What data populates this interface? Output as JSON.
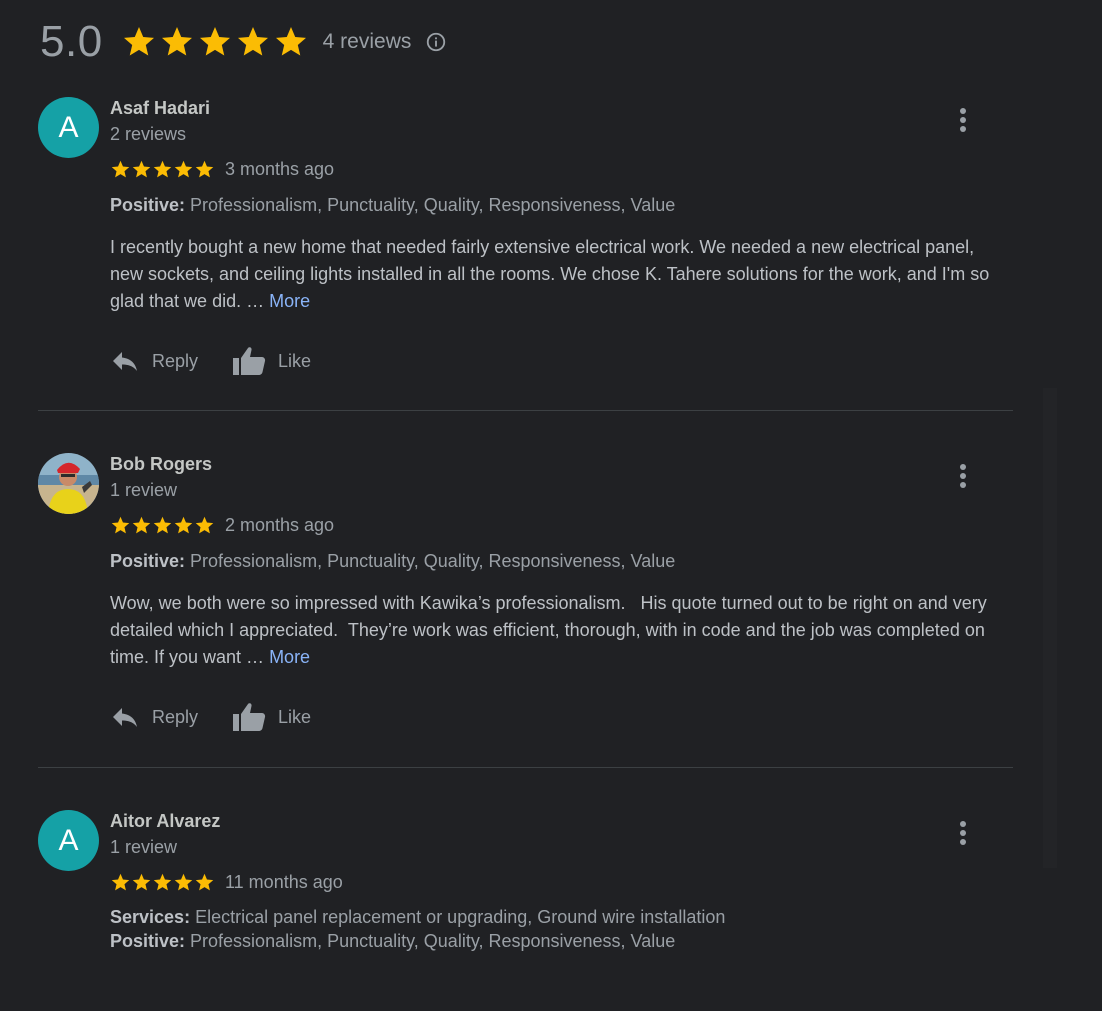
{
  "summary": {
    "score": "5.0",
    "stars": 5,
    "review_count": "4 reviews",
    "info_icon": "info-icon"
  },
  "colors": {
    "background": "#202124",
    "star": "#fbbc04",
    "link": "#8ab4f8",
    "avatar_teal": "#15a1a6",
    "divider": "#3c4043"
  },
  "actions": {
    "reply": "Reply",
    "like": "Like",
    "more": "More"
  },
  "reviews": [
    {
      "name": "Asaf Hadari",
      "avatar_letter": "A",
      "meta": "2 reviews",
      "rating": 5,
      "time": "3 months ago",
      "attributes": [
        {
          "label": "Positive:",
          "value": " Professionalism, Punctuality, Quality, Responsiveness, Value"
        }
      ],
      "text": "I recently bought a new home that needed fairly extensive electrical work. We needed a new electrical panel, new sockets, and ceiling lights installed in all the rooms. We chose K. Tahere solutions for the work, and I'm so glad that we did. … "
    },
    {
      "name": "Bob Rogers",
      "avatar_letter": "",
      "meta": "1 review",
      "rating": 5,
      "time": "2 months ago",
      "attributes": [
        {
          "label": "Positive:",
          "value": " Professionalism, Punctuality, Quality, Responsiveness, Value"
        }
      ],
      "text": "Wow, we both were so impressed with Kawika’s professionalism.   His quote turned out to be right on and very detailed which I appreciated.  They’re work was efficient, thorough, with in code and the job was completed on time. If you want … "
    },
    {
      "name": "Aitor Alvarez",
      "avatar_letter": "A",
      "meta": "1 review",
      "rating": 5,
      "time": "11 months ago",
      "attributes": [
        {
          "label": "Services:",
          "value": " Electrical panel replacement or upgrading, Ground wire installation"
        },
        {
          "label": "Positive:",
          "value": " Professionalism, Punctuality, Quality, Responsiveness, Value"
        }
      ],
      "text": ""
    }
  ]
}
